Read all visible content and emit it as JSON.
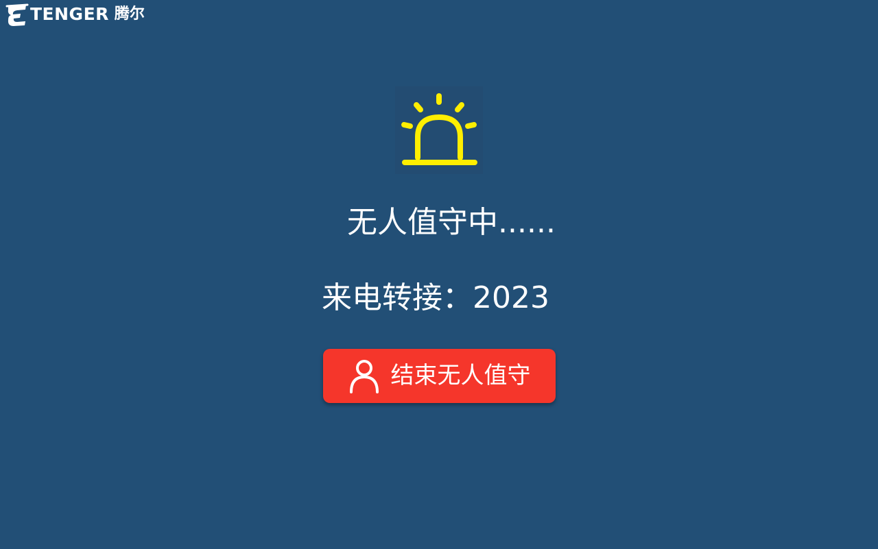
{
  "brand": {
    "wordmark": "TENGER",
    "name_cn": "腾尔"
  },
  "alarm": {
    "icon": "alarm-light-icon",
    "color": "#ffee00"
  },
  "status": {
    "text": "无人值守中......"
  },
  "forward": {
    "label": "来电转接：",
    "number": "2023"
  },
  "end_button": {
    "icon": "user-icon",
    "label": "结束无人值守",
    "color": "#f5362b"
  },
  "colors": {
    "background": "#224f76"
  }
}
